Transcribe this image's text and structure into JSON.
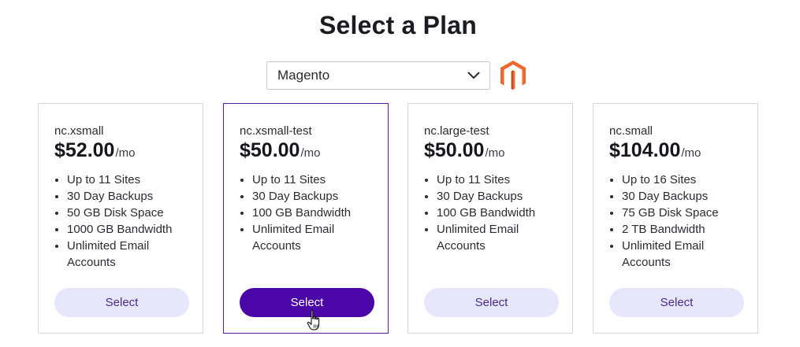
{
  "page": {
    "title": "Select a Plan"
  },
  "platform_select": {
    "selected": "Magento",
    "icon": "chevron-down-icon",
    "logo": "magento-logo",
    "logo_color": "#ee672f"
  },
  "plans": [
    {
      "name": "nc.xsmall",
      "price": "$52.00",
      "period": "/mo",
      "features": [
        "Up to 11 Sites",
        "30 Day Backups",
        "50 GB Disk Space",
        "1000 GB Bandwidth",
        "Unlimited Email Accounts"
      ],
      "button": "Select",
      "selected": false
    },
    {
      "name": "nc.xsmall-test",
      "price": "$50.00",
      "period": "/mo",
      "features": [
        "Up to 11 Sites",
        "30 Day Backups",
        "100 GB Bandwidth",
        "Unlimited Email Accounts"
      ],
      "button": "Select",
      "selected": true
    },
    {
      "name": "nc.large-test",
      "price": "$50.00",
      "period": "/mo",
      "features": [
        "Up to 11 Sites",
        "30 Day Backups",
        "100 GB Bandwidth",
        "Unlimited Email Accounts"
      ],
      "button": "Select",
      "selected": false
    },
    {
      "name": "nc.small",
      "price": "$104.00",
      "period": "/mo",
      "features": [
        "Up to 16 Sites",
        "30 Day Backups",
        "75 GB Disk Space",
        "2 TB Bandwidth",
        "Unlimited Email Accounts"
      ],
      "button": "Select",
      "selected": false
    }
  ],
  "colors": {
    "accent": "#4b06a8",
    "selected_border": "#5a1aa0",
    "button_bg": "#e6e7fb",
    "button_text": "#4b2a8c"
  }
}
